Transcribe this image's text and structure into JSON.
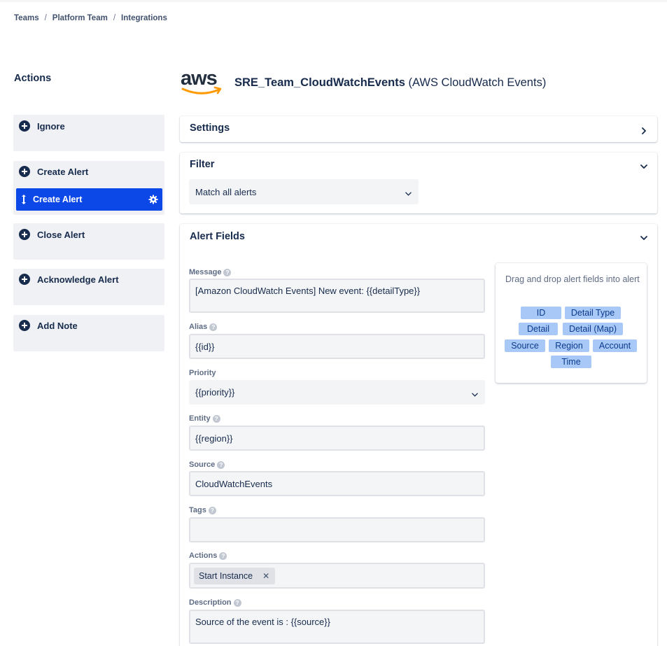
{
  "breadcrumb": [
    "Teams",
    "Platform Team",
    "Integrations"
  ],
  "sidebar": {
    "title": "Actions",
    "items": [
      {
        "label": "Ignore"
      },
      {
        "label": "Create Alert",
        "children": [
          {
            "label": "Create Alert",
            "active": true
          }
        ]
      },
      {
        "label": "Close Alert"
      },
      {
        "label": "Acknowledge Alert"
      },
      {
        "label": "Add Note"
      }
    ]
  },
  "header": {
    "logo_text": "aws",
    "integration_name": "SRE_Team_CloudWatchEvents",
    "integration_type": "(AWS CloudWatch Events)"
  },
  "settings": {
    "title": "Settings"
  },
  "filter": {
    "title": "Filter",
    "selected": "Match all alerts"
  },
  "alert_fields": {
    "title": "Alert Fields",
    "message": {
      "label": "Message",
      "value": "[Amazon CloudWatch Events] New event: {{detailType}}"
    },
    "alias": {
      "label": "Alias",
      "value": "{{id}}"
    },
    "priority": {
      "label": "Priority",
      "value": "{{priority}}"
    },
    "entity": {
      "label": "Entity",
      "value": "{{region}}"
    },
    "source": {
      "label": "Source",
      "value": "CloudWatchEvents"
    },
    "tags": {
      "label": "Tags",
      "value": ""
    },
    "actions": {
      "label": "Actions",
      "chips": [
        "Start Instance"
      ]
    },
    "description": {
      "label": "Description",
      "value": "Source of the event is : {{source}}"
    },
    "help_glyph": "?",
    "remove_glyph": "✕"
  },
  "drag_drop": {
    "hint": "Drag and drop alert fields into alert",
    "fields": [
      "ID",
      "Detail Type",
      "Detail",
      "Detail (Map)",
      "Source",
      "Region",
      "Account",
      "Time"
    ]
  },
  "colors": {
    "accent": "#0c48e8",
    "pill_bg": "#a8c8f8",
    "pill_text": "#0c3a8a",
    "aws_orange": "#f90"
  },
  "icons": [
    "plus-icon",
    "drag-handle-icon",
    "gear-icon",
    "chevron-right-icon",
    "chevron-down-icon",
    "help-icon",
    "close-icon"
  ]
}
